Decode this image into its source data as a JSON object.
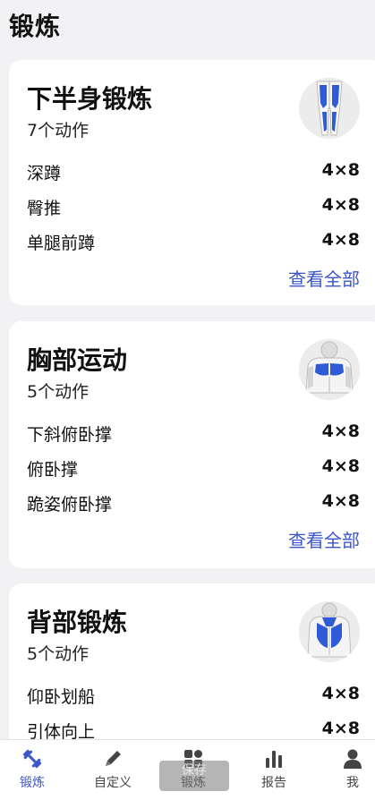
{
  "page": {
    "title": "锻炼"
  },
  "colors": {
    "accent": "#3b56c9",
    "muscle_highlight": "#2f5bd6",
    "card_bg": "#ffffff",
    "page_bg": "#f2f2f4"
  },
  "workouts": [
    {
      "title": "下半身锻炼",
      "count": "7个动作",
      "icon": "legs-muscle-icon",
      "exercises": [
        {
          "name": "深蹲",
          "sets": "4×8"
        },
        {
          "name": "臀推",
          "sets": "4×8"
        },
        {
          "name": "单腿前蹲",
          "sets": "4×8"
        }
      ],
      "view_all": "查看全部"
    },
    {
      "title": "胸部运动",
      "count": "5个动作",
      "icon": "chest-muscle-icon",
      "exercises": [
        {
          "name": "下斜俯卧撑",
          "sets": "4×8"
        },
        {
          "name": "俯卧撑",
          "sets": "4×8"
        },
        {
          "name": "跪姿俯卧撑",
          "sets": "4×8"
        }
      ],
      "view_all": "查看全部"
    },
    {
      "title": "背部锻炼",
      "count": "5个动作",
      "icon": "back-muscle-icon",
      "exercises": [
        {
          "name": "仰卧划船",
          "sets": "4×8"
        },
        {
          "name": "引体向上",
          "sets": "4×8"
        }
      ]
    }
  ],
  "tabbar": [
    {
      "label": "锻炼",
      "icon": "dumbbell-icon",
      "active": true
    },
    {
      "label": "自定义",
      "icon": "pencil-icon",
      "active": false
    },
    {
      "label": "锻炼",
      "icon": "grid-icon",
      "active": false
    },
    {
      "label": "报告",
      "icon": "bar-chart-icon",
      "active": false
    },
    {
      "label": "我",
      "icon": "person-icon",
      "active": false
    }
  ],
  "toast": {
    "text": "保存"
  }
}
